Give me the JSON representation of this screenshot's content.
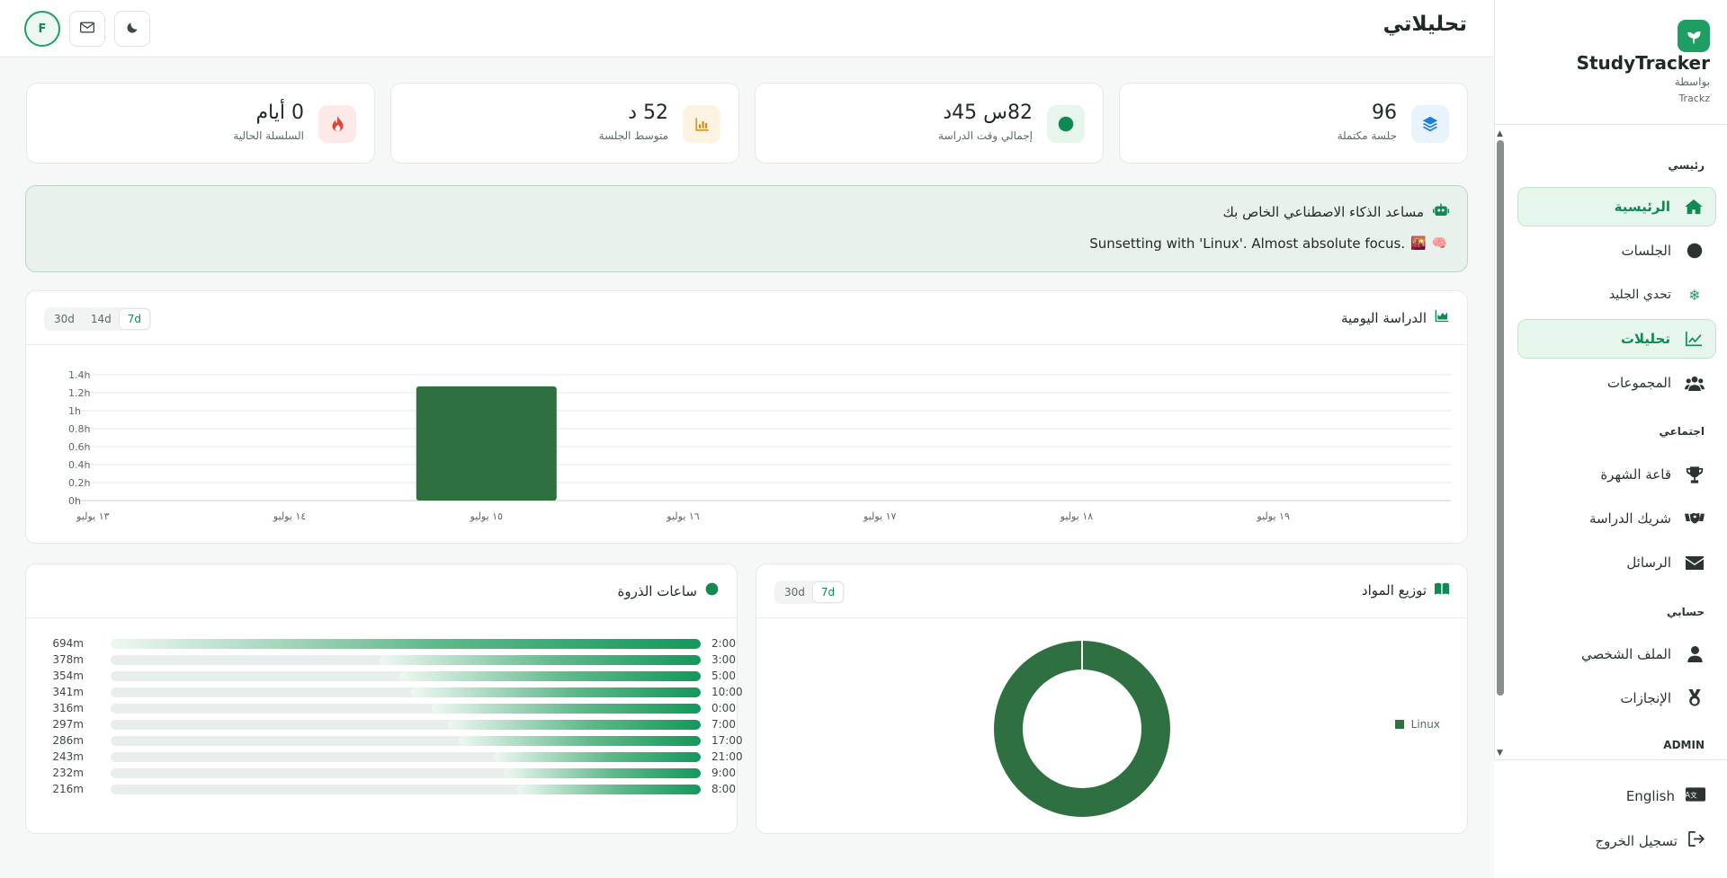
{
  "header": {
    "title": "تحليلاتي",
    "avatar_letter": "F"
  },
  "brand": {
    "name": "StudyTracker",
    "by": "بواسطة",
    "sub": "Trackz"
  },
  "nav": {
    "section_main": "رئيسي",
    "home": "الرئيسية",
    "sessions": "الجلسات",
    "ice": "تحدي الجليد",
    "analytics": "تحليلات",
    "groups": "المجموعات",
    "section_social": "اجتماعي",
    "hall": "قاعة الشهرة",
    "partner": "شريك الدراسة",
    "messages": "الرسائل",
    "section_account": "حسابي",
    "profile": "الملف الشخصي",
    "achievements": "الإنجازات",
    "section_admin": "ADMIN"
  },
  "bottom": {
    "language": "English",
    "logout": "تسجيل الخروج"
  },
  "stats": [
    {
      "value": "96",
      "label": "جلسة مكتملة",
      "icon": "layers-icon",
      "color": "#1e7fd6",
      "bg": "#e9f3fc"
    },
    {
      "value": "82س 45د",
      "label": "إجمالي وقت الدراسة",
      "icon": "clock-icon",
      "color": "#0f8a52",
      "bg": "#e6f6ed"
    },
    {
      "value": "52 د",
      "label": "متوسط الجلسة",
      "icon": "chart-icon",
      "color": "#d58a12",
      "bg": "#fdf3e1"
    },
    {
      "value": "0 أيام",
      "label": "السلسلة الحالية",
      "icon": "fire-icon",
      "color": "#e0443c",
      "bg": "#fde9e8"
    }
  ],
  "ai": {
    "title": "مساعد الذكاء الاصطناعي الخاص بك",
    "message": "Sunsetting with 'Linux'. Almost absolute focus."
  },
  "daily": {
    "title": "الدراسة اليومية",
    "ranges": [
      "30d",
      "14d",
      "7d"
    ],
    "active_range": "7d"
  },
  "subjects": {
    "title": "توزيع المواد",
    "ranges": [
      "30d",
      "7d"
    ],
    "active_range": "7d"
  },
  "peak": {
    "title": "ساعات الذروة",
    "rows": [
      {
        "hour": "2:00",
        "minutes": 694,
        "label": "694m"
      },
      {
        "hour": "3:00",
        "minutes": 378,
        "label": "378m"
      },
      {
        "hour": "5:00",
        "minutes": 354,
        "label": "354m"
      },
      {
        "hour": "10:00",
        "minutes": 341,
        "label": "341m"
      },
      {
        "hour": "0:00",
        "minutes": 316,
        "label": "316m"
      },
      {
        "hour": "7:00",
        "minutes": 297,
        "label": "297m"
      },
      {
        "hour": "17:00",
        "minutes": 286,
        "label": "286m"
      },
      {
        "hour": "21:00",
        "minutes": 243,
        "label": "243m"
      },
      {
        "hour": "9:00",
        "minutes": 232,
        "label": "232m"
      },
      {
        "hour": "8:00",
        "minutes": 216,
        "label": "216m"
      }
    ]
  },
  "chart_data": [
    {
      "type": "bar",
      "categories": [
        "١٣ يوليو",
        "١٤ يوليو",
        "١٥ يوليو",
        "١٦ يوليو",
        "١٧ يوليو",
        "١٨ يوليو",
        "١٩ يوليو"
      ],
      "values": [
        0,
        0,
        1.27,
        0,
        0,
        0,
        0
      ],
      "y_ticks": [
        "0h",
        "0.2h",
        "0.4h",
        "0.6h",
        "0.8h",
        "1h",
        "1.2h",
        "1.4h"
      ],
      "ylim": [
        0,
        1.4
      ],
      "grid": true,
      "color": "#2e7040"
    },
    {
      "type": "pie",
      "labels": [
        "Linux"
      ],
      "values": [
        100
      ],
      "colors": [
        "#2e7040"
      ],
      "legend": "right"
    }
  ]
}
